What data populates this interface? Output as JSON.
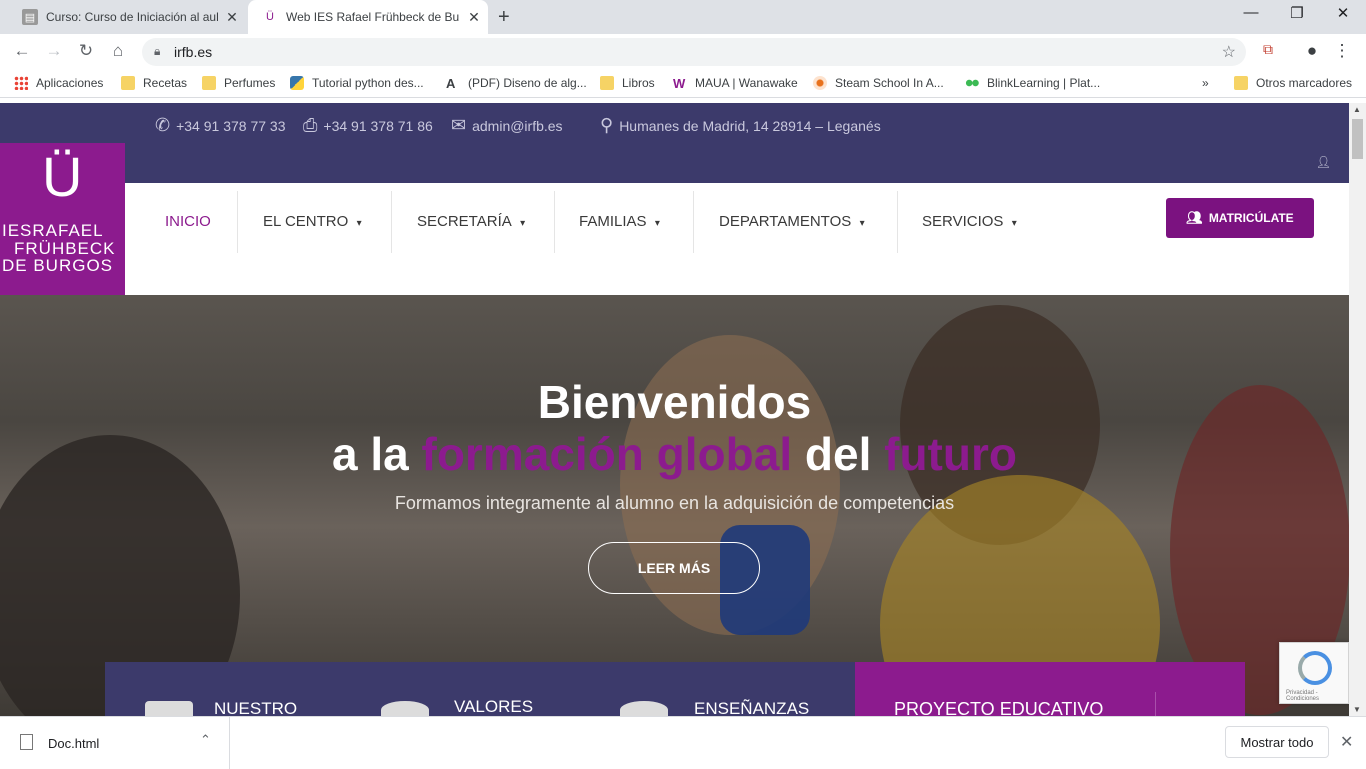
{
  "browser": {
    "tabs": [
      {
        "title": "Curso: Curso de Iniciación al aula",
        "favicon": "moodle-icon",
        "close": "✕"
      },
      {
        "title": "Web IES Rafael Frühbeck de Burgos",
        "favicon": "irfb-icon",
        "close": "✕"
      }
    ],
    "new_tab": "+",
    "window_controls": {
      "minimize": "—",
      "maximize": "❐",
      "close": "✕"
    },
    "url": "irfb.es",
    "bookmarks": [
      {
        "label": "Aplicaciones",
        "icon": "apps-grid-icon"
      },
      {
        "label": "Recetas",
        "icon": "folder-icon"
      },
      {
        "label": "Perfumes",
        "icon": "folder-icon"
      },
      {
        "label": "Tutorial python des...",
        "icon": "python-icon"
      },
      {
        "label": "(PDF) Diseno de alg...",
        "icon": "academia-icon"
      },
      {
        "label": "Libros",
        "icon": "folder-icon"
      },
      {
        "label": "MAUA | Wanawake",
        "icon": "wanawake-icon"
      },
      {
        "label": "Steam School In A...",
        "icon": "steam-icon"
      },
      {
        "label": "BlinkLearning | Plat...",
        "icon": "blink-icon"
      }
    ],
    "more_bookmarks": "»",
    "other_bookmarks": "Otros marcadores"
  },
  "site": {
    "contact": {
      "phone": "+34 91 378 77 33",
      "fax": "+34 91 378 71 86",
      "email": "admin@irfb.es",
      "address": "Humanes de Madrid, 14 28914 – Leganés"
    },
    "logo": {
      "mark": "Ü",
      "line1": "IESRAFAEL",
      "line2": "FRÜHBECK",
      "line3": "DE BURGOS"
    },
    "menu": [
      {
        "label": "INICIO",
        "active": true,
        "dropdown": ""
      },
      {
        "label": "EL CENTRO",
        "active": false,
        "dropdown": "▾"
      },
      {
        "label": "SECRETARÍA",
        "active": false,
        "dropdown": "▾"
      },
      {
        "label": "FAMILIAS",
        "active": false,
        "dropdown": "▾"
      },
      {
        "label": "DEPARTAMENTOS",
        "active": false,
        "dropdown": "▾"
      },
      {
        "label": "SERVICIOS",
        "active": false,
        "dropdown": "▾"
      }
    ],
    "cta": "MATRICÚLATE",
    "hero": {
      "line1": "Bienvenidos",
      "line2_a": "a la ",
      "line2_b": "formación global",
      "line2_c": " del ",
      "line2_d": "futuro",
      "subtitle": "Formamos integramente al alumno en la adquisición de competencias",
      "button": "LEER MÁS"
    },
    "features": [
      {
        "label": "NUESTRO"
      },
      {
        "label": "VALORES"
      },
      {
        "label": "ENSEÑANZAS"
      },
      {
        "label": "PROYECTO EDUCATIVO"
      }
    ],
    "recaptcha": "Privacidad - Condiciones"
  },
  "downloads": {
    "file": "Doc.html",
    "show_all": "Mostrar todo"
  },
  "colors": {
    "brand_purple": "#8c1b8e",
    "navy": "#3c3a6b"
  }
}
